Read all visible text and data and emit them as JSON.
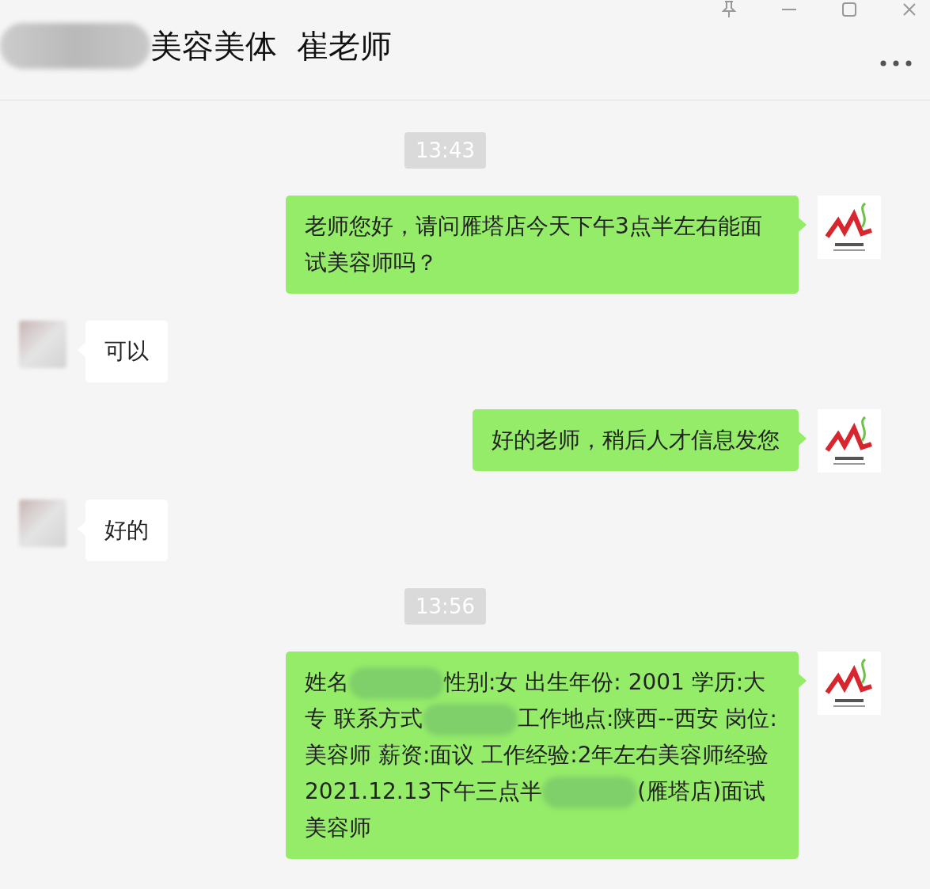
{
  "window": {
    "title": "美容美体  崔老师"
  },
  "messages": [
    {
      "kind": "time",
      "text": "13:43"
    },
    {
      "kind": "sent",
      "segments": [
        {
          "kind": "text",
          "text": "老师您好，请问雁塔店今天下午3点半左右能面试美容师吗？"
        }
      ]
    },
    {
      "kind": "received",
      "segments": [
        {
          "kind": "text",
          "text": "可以"
        }
      ]
    },
    {
      "kind": "sent",
      "segments": [
        {
          "kind": "text",
          "text": "好的老师，稍后人才信息发您"
        }
      ]
    },
    {
      "kind": "received",
      "segments": [
        {
          "kind": "text",
          "text": "好的"
        }
      ]
    },
    {
      "kind": "time",
      "text": "13:56"
    },
    {
      "kind": "sent",
      "segments": [
        {
          "kind": "text",
          "text": "姓名"
        },
        {
          "kind": "redacted"
        },
        {
          "kind": "text",
          "text": "性别:女 出生年份: 2001 学历:大专 联系方式"
        },
        {
          "kind": "redacted"
        },
        {
          "kind": "text",
          "text": "工作地点:陕西--西安 岗位:美容师 薪资:面议 工作经验:2年左右美容师经验 2021.12.13下午三点半"
        },
        {
          "kind": "redacted"
        },
        {
          "kind": "text",
          "text": "(雁塔店)面试美容师"
        }
      ]
    }
  ]
}
